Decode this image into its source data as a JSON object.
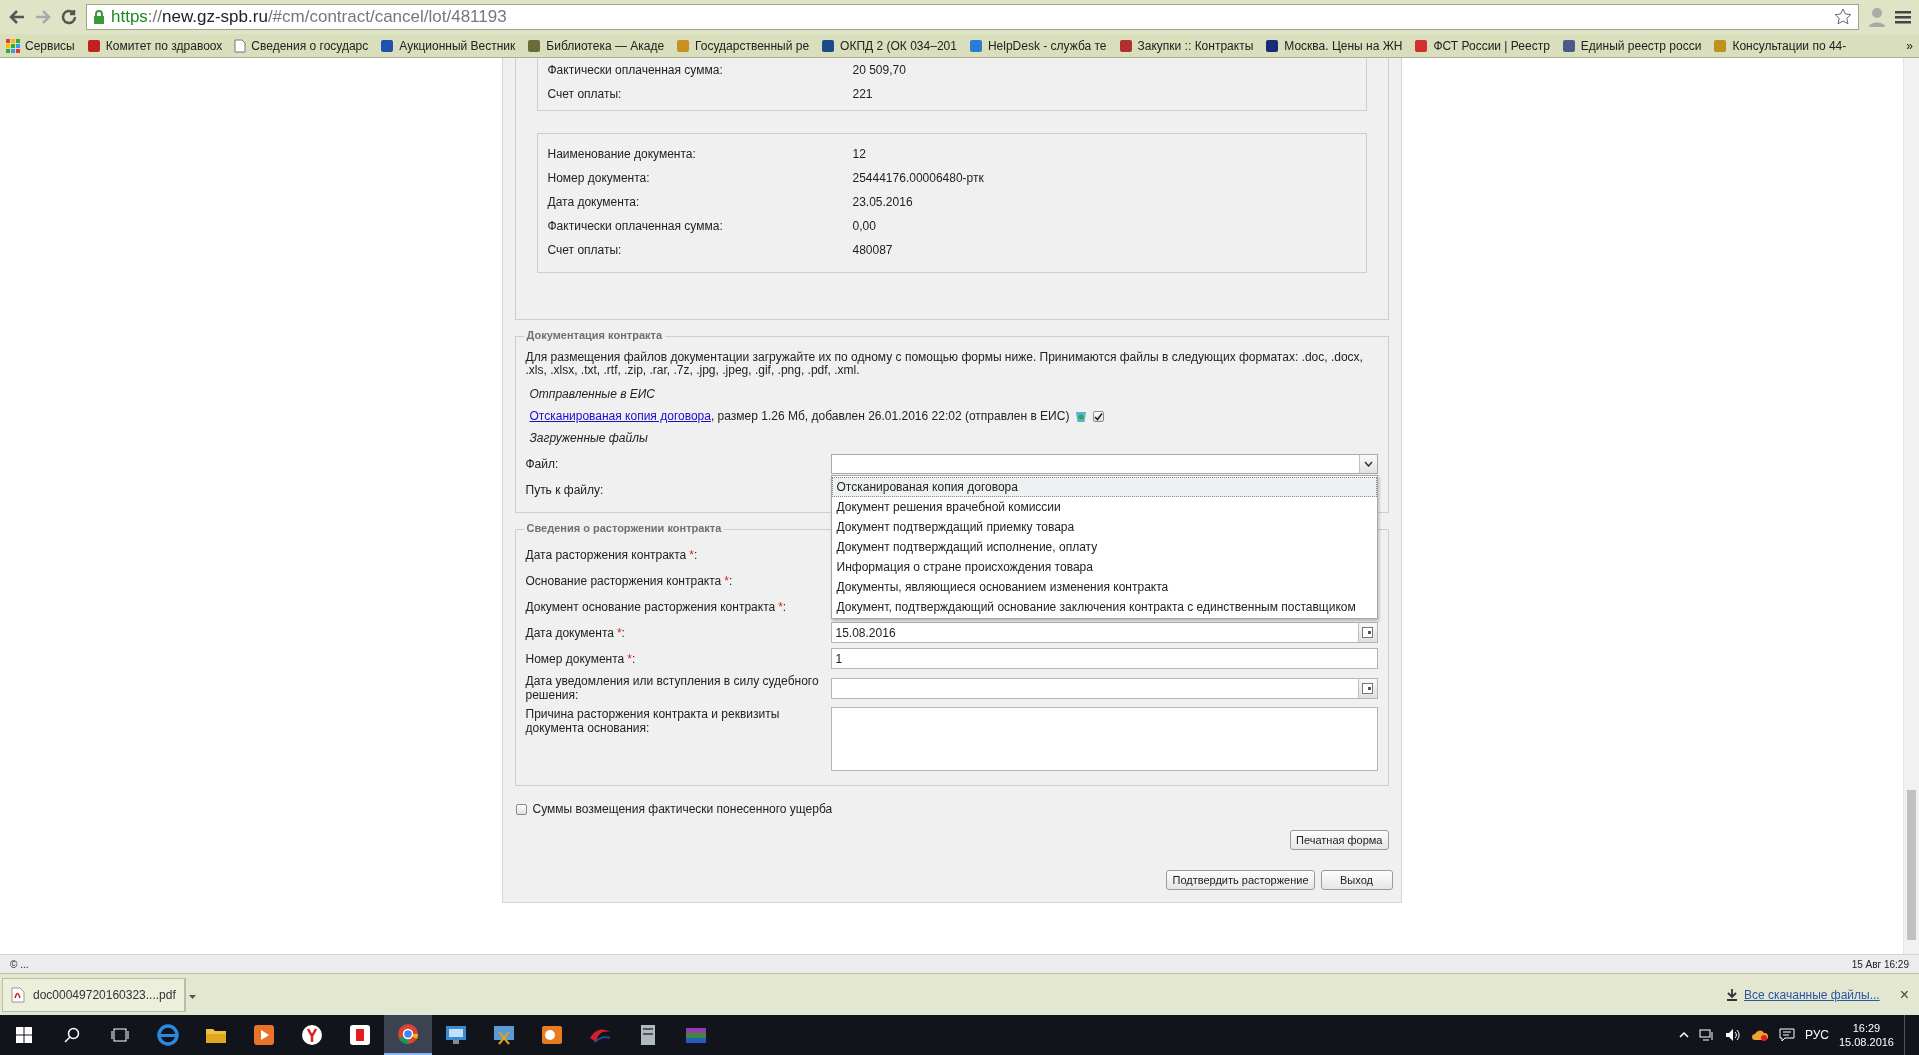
{
  "browser": {
    "url": {
      "scheme": "https",
      "separator": "://",
      "host": "new.gz-spb.ru",
      "path": "/#cm/contract/cancel/lot/481193"
    },
    "bookmarks": [
      {
        "label": "Сервисы"
      },
      {
        "label": "Комитет по здравоох"
      },
      {
        "label": "Сведения о государс"
      },
      {
        "label": "Аукционный Вестник"
      },
      {
        "label": "Библиотека — Акаде"
      },
      {
        "label": "Государственный ре"
      },
      {
        "label": "ОКПД 2 (ОК 034–201"
      },
      {
        "label": "HelpDesk - служба те"
      },
      {
        "label": "Закупки :: Контракты"
      },
      {
        "label": "Москва. Цены на ЖН"
      },
      {
        "label": "ФСТ России | Реестр"
      },
      {
        "label": "Единый реестр росси"
      },
      {
        "label": "Консультации по 44-"
      }
    ],
    "more": "»"
  },
  "payment_documents": [
    {
      "cut_top": true,
      "rows": [
        {
          "label": "Фактически оплаченная сумма:",
          "value": "20 509,70"
        },
        {
          "label": "Счет оплаты:",
          "value": "221"
        }
      ]
    },
    {
      "cut_top": false,
      "rows": [
        {
          "label": "Наименование документа:",
          "value": "12"
        },
        {
          "label": "Номер документа:",
          "value": "25444176.00006480-ртк"
        },
        {
          "label": "Дата документа:",
          "value": "23.05.2016"
        },
        {
          "label": "Фактически оплаченная сумма:",
          "value": "0,00"
        },
        {
          "label": "Счет оплаты:",
          "value": "480087"
        }
      ]
    }
  ],
  "documentation": {
    "legend": "Документация контракта",
    "description": "Для размещения файлов документации загружайте их по одному с помощью формы ниже. Принимаются файлы в следующих форматах: .doc, .docx, .xls, .xlsx, .txt, .rtf, .zip, .rar, .7z, .jpg, .jpeg, .gif, .png, .pdf, .xml.",
    "sent_heading": "Отправленные в ЕИС",
    "sent_file": {
      "link": "Отсканированая копия договора",
      "details": ", размер 1.26 Мб, добавлен 26.01.2016 22:02 (отправлен в ЕИС)",
      "checked": true
    },
    "uploaded_heading": "Загруженные файлы",
    "file_label": "Файл:",
    "path_label": "Путь к файлу:",
    "dropdown": {
      "expanded": true,
      "options": [
        {
          "label": "Отсканированая копия договора",
          "selected": true
        },
        {
          "label": "Документ решения врачебной комиссии",
          "selected": false
        },
        {
          "label": "Документ подтверждащий приемку товара",
          "selected": false
        },
        {
          "label": "Документ подтверждащий исполнение, оплату",
          "selected": false
        },
        {
          "label": "Информация о стране происхождения товара",
          "selected": false
        },
        {
          "label": "Документы, являющиеся основанием изменения контракта",
          "selected": false
        },
        {
          "label": "Документ, подтверждающий основание заключения контракта с единственным поставщиком",
          "selected": false
        }
      ]
    }
  },
  "termination": {
    "legend": "Сведения о расторжении контракта",
    "fields": [
      {
        "label": "Дата расторжения контракта",
        "required_mark": "*",
        "label_end": ":",
        "kind": "covered"
      },
      {
        "label": "Основание расторжения контракта",
        "required_mark": "*",
        "label_end": ":",
        "kind": "covered"
      },
      {
        "label": "Документ основание расторжения контракта",
        "required_mark": "*",
        "label_end": ":",
        "kind": "covered"
      },
      {
        "label": "Дата документа",
        "required_mark": "*",
        "label_end": ":",
        "kind": "date",
        "value": "15.08.2016"
      },
      {
        "label": "Номер документа",
        "required_mark": "*",
        "label_end": ":",
        "kind": "text",
        "value": "1"
      },
      {
        "label": "Дата уведомления или вступления в силу судебного решения:",
        "kind": "date"
      },
      {
        "label": "Причина расторжения контракта и реквизиты документа основания:",
        "kind": "textarea"
      }
    ]
  },
  "damages": {
    "label": "Суммы возмещения фактически понесенного ущерба",
    "checked": false
  },
  "print_button": "Печатная форма",
  "actions": [
    "Подтвердить расторжение",
    "Выход"
  ],
  "footer": {
    "left": "© ...",
    "right": "15 Авг 16:29"
  },
  "download": {
    "file": "doc00049720160323....pdf",
    "all_link": "Все скачанные файлы...",
    "close": "×"
  },
  "taskbar": {
    "language": "РУС",
    "time": "16:29",
    "date": "15.08.2016"
  }
}
